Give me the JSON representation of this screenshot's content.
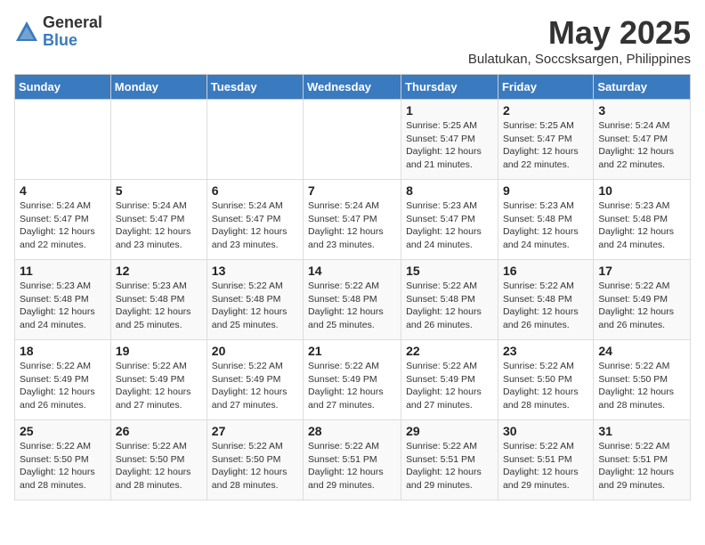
{
  "logo": {
    "general": "General",
    "blue": "Blue"
  },
  "title": "May 2025",
  "subtitle": "Bulatukan, Soccsksargen, Philippines",
  "days_of_week": [
    "Sunday",
    "Monday",
    "Tuesday",
    "Wednesday",
    "Thursday",
    "Friday",
    "Saturday"
  ],
  "weeks": [
    [
      {
        "day": "",
        "info": ""
      },
      {
        "day": "",
        "info": ""
      },
      {
        "day": "",
        "info": ""
      },
      {
        "day": "",
        "info": ""
      },
      {
        "day": "1",
        "info": "Sunrise: 5:25 AM\nSunset: 5:47 PM\nDaylight: 12 hours\nand 21 minutes."
      },
      {
        "day": "2",
        "info": "Sunrise: 5:25 AM\nSunset: 5:47 PM\nDaylight: 12 hours\nand 22 minutes."
      },
      {
        "day": "3",
        "info": "Sunrise: 5:24 AM\nSunset: 5:47 PM\nDaylight: 12 hours\nand 22 minutes."
      }
    ],
    [
      {
        "day": "4",
        "info": "Sunrise: 5:24 AM\nSunset: 5:47 PM\nDaylight: 12 hours\nand 22 minutes."
      },
      {
        "day": "5",
        "info": "Sunrise: 5:24 AM\nSunset: 5:47 PM\nDaylight: 12 hours\nand 23 minutes."
      },
      {
        "day": "6",
        "info": "Sunrise: 5:24 AM\nSunset: 5:47 PM\nDaylight: 12 hours\nand 23 minutes."
      },
      {
        "day": "7",
        "info": "Sunrise: 5:24 AM\nSunset: 5:47 PM\nDaylight: 12 hours\nand 23 minutes."
      },
      {
        "day": "8",
        "info": "Sunrise: 5:23 AM\nSunset: 5:47 PM\nDaylight: 12 hours\nand 24 minutes."
      },
      {
        "day": "9",
        "info": "Sunrise: 5:23 AM\nSunset: 5:48 PM\nDaylight: 12 hours\nand 24 minutes."
      },
      {
        "day": "10",
        "info": "Sunrise: 5:23 AM\nSunset: 5:48 PM\nDaylight: 12 hours\nand 24 minutes."
      }
    ],
    [
      {
        "day": "11",
        "info": "Sunrise: 5:23 AM\nSunset: 5:48 PM\nDaylight: 12 hours\nand 24 minutes."
      },
      {
        "day": "12",
        "info": "Sunrise: 5:23 AM\nSunset: 5:48 PM\nDaylight: 12 hours\nand 25 minutes."
      },
      {
        "day": "13",
        "info": "Sunrise: 5:22 AM\nSunset: 5:48 PM\nDaylight: 12 hours\nand 25 minutes."
      },
      {
        "day": "14",
        "info": "Sunrise: 5:22 AM\nSunset: 5:48 PM\nDaylight: 12 hours\nand 25 minutes."
      },
      {
        "day": "15",
        "info": "Sunrise: 5:22 AM\nSunset: 5:48 PM\nDaylight: 12 hours\nand 26 minutes."
      },
      {
        "day": "16",
        "info": "Sunrise: 5:22 AM\nSunset: 5:48 PM\nDaylight: 12 hours\nand 26 minutes."
      },
      {
        "day": "17",
        "info": "Sunrise: 5:22 AM\nSunset: 5:49 PM\nDaylight: 12 hours\nand 26 minutes."
      }
    ],
    [
      {
        "day": "18",
        "info": "Sunrise: 5:22 AM\nSunset: 5:49 PM\nDaylight: 12 hours\nand 26 minutes."
      },
      {
        "day": "19",
        "info": "Sunrise: 5:22 AM\nSunset: 5:49 PM\nDaylight: 12 hours\nand 27 minutes."
      },
      {
        "day": "20",
        "info": "Sunrise: 5:22 AM\nSunset: 5:49 PM\nDaylight: 12 hours\nand 27 minutes."
      },
      {
        "day": "21",
        "info": "Sunrise: 5:22 AM\nSunset: 5:49 PM\nDaylight: 12 hours\nand 27 minutes."
      },
      {
        "day": "22",
        "info": "Sunrise: 5:22 AM\nSunset: 5:49 PM\nDaylight: 12 hours\nand 27 minutes."
      },
      {
        "day": "23",
        "info": "Sunrise: 5:22 AM\nSunset: 5:50 PM\nDaylight: 12 hours\nand 28 minutes."
      },
      {
        "day": "24",
        "info": "Sunrise: 5:22 AM\nSunset: 5:50 PM\nDaylight: 12 hours\nand 28 minutes."
      }
    ],
    [
      {
        "day": "25",
        "info": "Sunrise: 5:22 AM\nSunset: 5:50 PM\nDaylight: 12 hours\nand 28 minutes."
      },
      {
        "day": "26",
        "info": "Sunrise: 5:22 AM\nSunset: 5:50 PM\nDaylight: 12 hours\nand 28 minutes."
      },
      {
        "day": "27",
        "info": "Sunrise: 5:22 AM\nSunset: 5:50 PM\nDaylight: 12 hours\nand 28 minutes."
      },
      {
        "day": "28",
        "info": "Sunrise: 5:22 AM\nSunset: 5:51 PM\nDaylight: 12 hours\nand 29 minutes."
      },
      {
        "day": "29",
        "info": "Sunrise: 5:22 AM\nSunset: 5:51 PM\nDaylight: 12 hours\nand 29 minutes."
      },
      {
        "day": "30",
        "info": "Sunrise: 5:22 AM\nSunset: 5:51 PM\nDaylight: 12 hours\nand 29 minutes."
      },
      {
        "day": "31",
        "info": "Sunrise: 5:22 AM\nSunset: 5:51 PM\nDaylight: 12 hours\nand 29 minutes."
      }
    ]
  ]
}
